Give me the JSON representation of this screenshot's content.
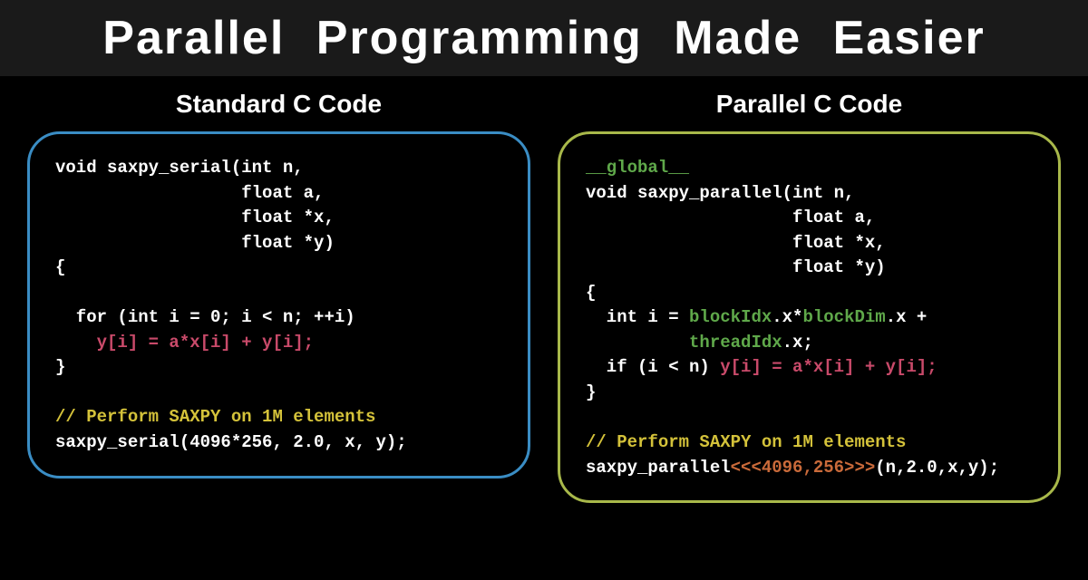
{
  "title": "Parallel Programming Made Easier",
  "panels": {
    "left": {
      "subtitle": "Standard C Code",
      "code": {
        "sig1": "void saxpy_serial(int n,",
        "sig2": "                  float a,",
        "sig3": "                  float *x,",
        "sig4": "                  float *y)",
        "open": "{",
        "blank": "",
        "for": "  for (int i = 0; i < n; ++i)",
        "body": "    y[i] = a*x[i] + y[i];",
        "close": "}",
        "comment": "// Perform SAXPY on 1M elements",
        "call": "saxpy_serial(4096*256, 2.0, x, y);"
      }
    },
    "right": {
      "subtitle": "Parallel C Code",
      "code": {
        "global": "__global__",
        "sig1": "void saxpy_parallel(int n,",
        "sig2": "                    float a,",
        "sig3": "                    float *x,",
        "sig4": "                    float *y)",
        "open": "{",
        "idx_pre": "  int i = ",
        "idx_bi": "blockIdx",
        "idx_mid1": ".x*",
        "idx_bd": "blockDim",
        "idx_mid2": ".x +",
        "idx_ind": "          ",
        "idx_ti": "threadIdx",
        "idx_end": ".x;",
        "if_pre": "  if (i < n) ",
        "if_body": "y[i] = a*x[i] + y[i];",
        "close": "}",
        "comment": "// Perform SAXPY on 1M elements",
        "call_pre": "saxpy_parallel",
        "call_tri": "<<<4096,256>>>",
        "call_post": "(n,2.0,x,y);"
      }
    }
  }
}
